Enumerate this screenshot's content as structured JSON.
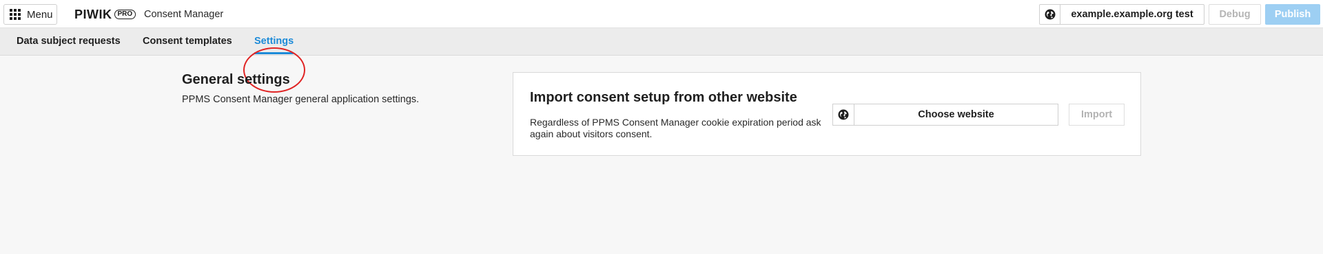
{
  "header": {
    "menu_label": "Menu",
    "logo_word": "PIWIK",
    "logo_badge": "PRO",
    "app_name": "Consent Manager",
    "site_label": "example.example.org test",
    "debug_label": "Debug",
    "publish_label": "Publish"
  },
  "tabs": [
    {
      "label": "Data subject requests",
      "active": false
    },
    {
      "label": "Consent templates",
      "active": false
    },
    {
      "label": "Settings",
      "active": true
    }
  ],
  "general": {
    "title": "General settings",
    "description": "PPMS Consent Manager general application settings."
  },
  "import_card": {
    "title": "Import consent setup from other website",
    "description": "Regardless of PPMS Consent Manager cookie expiration period ask again about visitors consent.",
    "choose_label": "Choose website",
    "import_label": "Import"
  },
  "colors": {
    "accent": "#1d8bd8",
    "publish_bg": "#9dcff3",
    "highlight": "#e02424"
  },
  "icons": [
    "apps-grid-icon",
    "globe-icon"
  ]
}
